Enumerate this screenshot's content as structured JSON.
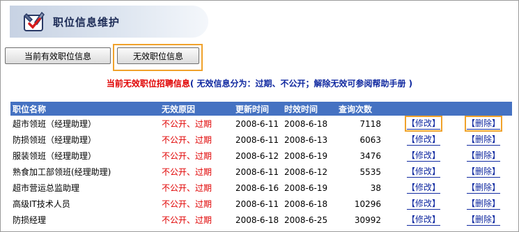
{
  "header": {
    "title": "职位信息维护",
    "logo_icon": "tools-logo-icon"
  },
  "buttons": {
    "current_valid": "当前有效职位信息",
    "invalid": "无效职位信息"
  },
  "notice": {
    "red_part": "当前无效职位招聘信息",
    "blue_part": "( 无效信息分为：过期、不公开；解除无效可参阅帮助手册 )"
  },
  "table": {
    "headers": [
      "职位名称",
      "无效原因",
      "更新时间",
      "时效时间",
      "查询次数",
      "",
      ""
    ],
    "rows": [
      {
        "name": "超市领班（经理助理）",
        "reason": "不公开、过期",
        "updated": "2008-6-11",
        "expires": "2008-6-18",
        "views": "7118",
        "edit": "【修改】",
        "delete": "【删除】"
      },
      {
        "name": "防损领班（经理助理）",
        "reason": "不公开、过期",
        "updated": "2008-6-11",
        "expires": "2008-6-13",
        "views": "6063",
        "edit": "【修改】",
        "delete": "【删除】"
      },
      {
        "name": "服装领班（经理助理）",
        "reason": "不公开、过期",
        "updated": "2008-6-12",
        "expires": "2008-6-19",
        "views": "3476",
        "edit": "【修改】",
        "delete": "【删除】"
      },
      {
        "name": "熟食加工部领班(经理助理)",
        "reason": "不公开、过期",
        "updated": "2008-6-11",
        "expires": "2008-6-12",
        "views": "5535",
        "edit": "【修改】",
        "delete": "【删除】"
      },
      {
        "name": "超市营运总监助理",
        "reason": "不公开、过期",
        "updated": "2008-6-16",
        "expires": "2008-6-19",
        "views": "38",
        "edit": "【修改】",
        "delete": "【删除】"
      },
      {
        "name": "高级IT技术人员",
        "reason": "不公开、过期",
        "updated": "2008-6-11",
        "expires": "2008-6-18",
        "views": "10296",
        "edit": "【修改】",
        "delete": "【删除】"
      },
      {
        "name": "防损经理",
        "reason": "不公开、过期",
        "updated": "2008-6-18",
        "expires": "2008-6-25",
        "views": "30992",
        "edit": "【修改】",
        "delete": "【删除】"
      }
    ]
  },
  "colors": {
    "header_row": "#4572c2",
    "reason_text": "#e00000",
    "link_text": "#1029a0",
    "highlight": "#f0a22b"
  }
}
